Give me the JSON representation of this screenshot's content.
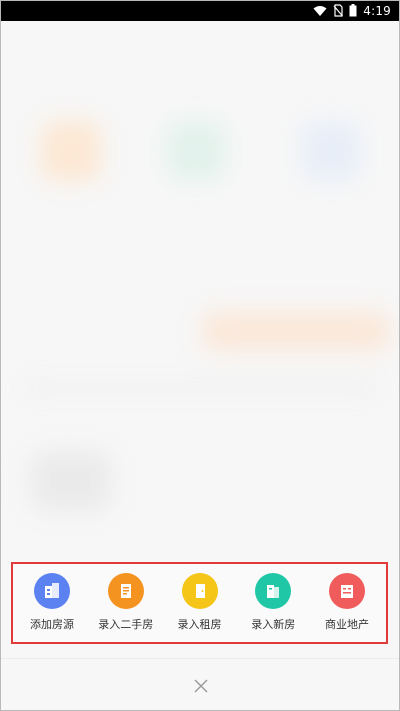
{
  "status_bar": {
    "time": "4:19",
    "icons": [
      "wifi-icon",
      "no-sim-icon",
      "battery-icon"
    ]
  },
  "actions": [
    {
      "label": "添加房源",
      "icon": "building-icon",
      "color": "#5b82f0"
    },
    {
      "label": "录入二手房",
      "icon": "document-icon",
      "color": "#f59321"
    },
    {
      "label": "录入租房",
      "icon": "door-icon",
      "color": "#f5c518"
    },
    {
      "label": "录入新房",
      "icon": "new-building-icon",
      "color": "#1fc7a6"
    },
    {
      "label": "商业地产",
      "icon": "office-building-icon",
      "color": "#f05b5b"
    }
  ],
  "close_icon": "close-icon"
}
